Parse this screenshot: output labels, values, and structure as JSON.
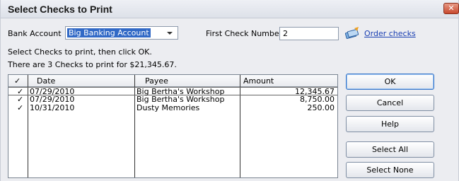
{
  "window": {
    "title": "Select Checks to Print",
    "close_glyph": "✕"
  },
  "bank_account": {
    "label": "Bank Account",
    "value": "Big Banking Account"
  },
  "first_check": {
    "label": "First Check Number",
    "value": "2"
  },
  "order_checks": {
    "label": "Order checks",
    "icon": "checks-icon"
  },
  "instructions": {
    "line1": "Select Checks to print, then click OK.",
    "line2": "There are 3 Checks to print for $21,345.67."
  },
  "table": {
    "headers": {
      "check": "✓",
      "date": "Date",
      "payee": "Payee",
      "amount": "Amount"
    },
    "rows": [
      {
        "check": "✓",
        "date": "07/29/2010",
        "payee": "Big Bertha's Workshop",
        "amount": "12,345.67"
      },
      {
        "check": "✓",
        "date": "07/29/2010",
        "payee": "Big Bertha's Workshop",
        "amount": "8,750.00"
      },
      {
        "check": "✓",
        "date": "10/31/2010",
        "payee": "Dusty Memories",
        "amount": "250.00"
      }
    ]
  },
  "buttons": {
    "ok": "OK",
    "cancel": "Cancel",
    "help": "Help",
    "select_all": "Select All",
    "select_none": "Select None"
  }
}
